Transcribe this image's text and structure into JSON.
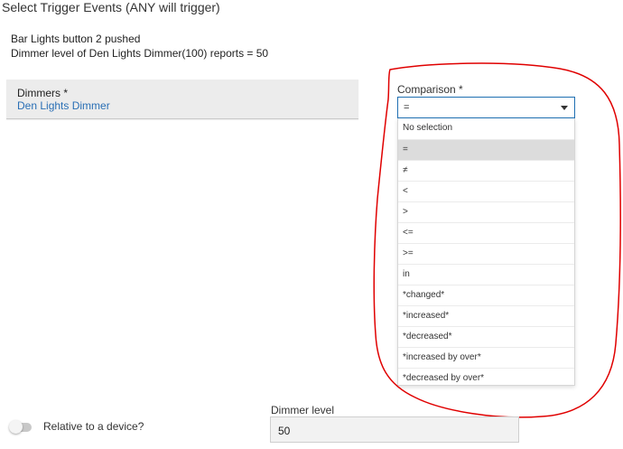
{
  "header": {
    "title": "Select Trigger Events (ANY will trigger)"
  },
  "summary": {
    "lines": [
      "Bar Lights button 2 pushed",
      "Dimmer level of Den Lights Dimmer(100) reports = 50"
    ]
  },
  "dimmers": {
    "label": "Dimmers *",
    "value": "Den Lights Dimmer"
  },
  "comparison": {
    "label": "Comparison *",
    "selected": "=",
    "options": [
      "No selection",
      "=",
      "≠",
      "<",
      ">",
      "<=",
      ">=",
      "in",
      "*changed*",
      "*increased*",
      "*decreased*",
      "*increased by over*",
      "*decreased by over*"
    ],
    "selected_index": 1
  },
  "relative": {
    "label": "Relative to a device?",
    "enabled": false
  },
  "dimmer_level": {
    "label": "Dimmer level",
    "value": "50"
  },
  "colors": {
    "link": "#2a6fb5",
    "focus_border": "#1f6fb2",
    "annotation": "#e00000"
  }
}
